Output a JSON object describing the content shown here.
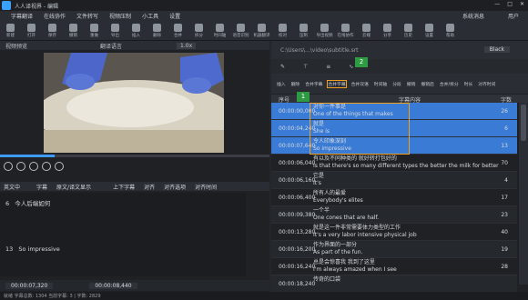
{
  "window": {
    "title": "人人译视界 - 编辑",
    "controls": [
      "—",
      "□",
      "✕"
    ]
  },
  "menu": {
    "items": [
      "字幕翻译",
      "在线协作",
      "文件转写",
      "视频压制",
      "小工具",
      "设置"
    ],
    "right": [
      "系统消息",
      "用户"
    ]
  },
  "toolbar": {
    "items": [
      {
        "label": "新建",
        "icon": "new-icon"
      },
      {
        "label": "打开",
        "icon": "folder-icon"
      },
      {
        "label": "保存",
        "icon": "save-icon"
      },
      {
        "label": "撤销",
        "icon": "undo-icon"
      },
      {
        "label": "重做",
        "icon": "redo-icon"
      },
      {
        "label": "导出",
        "icon": "export-icon"
      },
      {
        "label": "插入",
        "icon": "insert-icon"
      },
      {
        "label": "删除",
        "icon": "delete-icon"
      },
      {
        "label": "合并",
        "icon": "merge-icon"
      },
      {
        "label": "拆分",
        "icon": "split-icon"
      },
      {
        "label": "时间轴",
        "icon": "timeline-icon"
      },
      {
        "label": "语音识别",
        "icon": "mic-icon"
      },
      {
        "label": "机器翻译",
        "icon": "translate-icon"
      },
      {
        "label": "校对",
        "icon": "proof-icon"
      },
      {
        "label": "压制",
        "icon": "burn-icon"
      },
      {
        "label": "导出视频",
        "icon": "video-icon"
      },
      {
        "label": "在线协作",
        "icon": "cloud-icon"
      },
      {
        "label": "云端",
        "icon": "upload-icon"
      },
      {
        "label": "分享",
        "icon": "share-icon"
      },
      {
        "label": "历史",
        "icon": "history-icon"
      },
      {
        "label": "设置",
        "icon": "settings-icon"
      },
      {
        "label": "帮助",
        "icon": "help-icon"
      }
    ]
  },
  "player": {
    "header": "视频预览",
    "subtitle_lang": "翻译语言",
    "speed": "1.0x"
  },
  "editor": {
    "toolbar": [
      "英文中",
      "字幕",
      "原文/译文显示",
      "上下字幕",
      "对齐",
      "对齐选项",
      "对齐时间"
    ],
    "lines": [
      {
        "index": "6",
        "text": "今人后端如何"
      },
      {
        "index": "13",
        "text": "So impressive"
      }
    ],
    "start_time": "00:00:07,320",
    "end_time": "00:00:08,440"
  },
  "subtitle_panel": {
    "path": "C:\\Users\\...\\video\\subtitle.srt",
    "dropdown": "Black",
    "tools": [
      "插入",
      "删除",
      "合并字幕",
      "合并字幕",
      "合并双语",
      "时间轴",
      "分段",
      "撤销",
      "撤销后",
      "合并/拆分",
      "时长",
      "对齐时间"
    ],
    "columns": [
      "序号",
      "字幕内容",
      "字数"
    ],
    "rows": [
      {
        "time": "00:00:00,000",
        "zh": "对你一件事是",
        "en": "One of the things that makes",
        "count": "26",
        "selected": true
      },
      {
        "time": "00:00:04,240",
        "zh": "就是",
        "en": "She is",
        "count": "6",
        "selected": true
      },
      {
        "time": "00:00:07,640",
        "zh": "令人印象深刻",
        "en": "So impressive",
        "count": "13",
        "selected": true
      },
      {
        "time": "00:00:06,040",
        "zh": "有以及不同种类的 就好转打包好的",
        "en": "Is that there's so many different types the better the milk for better",
        "count": "70",
        "selected": false
      },
      {
        "time": "00:00:06,160",
        "zh": "它是",
        "en": "It's",
        "count": "4",
        "selected": false
      },
      {
        "time": "00:00:06,400",
        "zh": "所有人的最爱",
        "en": "Everybody's elites",
        "count": "17",
        "selected": false
      },
      {
        "time": "00:00:09,380",
        "zh": "一个半",
        "en": "One cones that are half.",
        "count": "23",
        "selected": false
      },
      {
        "time": "00:00:13,280",
        "zh": "就是这一件非常需要体力类型的工作",
        "en": "It's a very labor intensive physical job",
        "count": "40",
        "selected": false
      },
      {
        "time": "00:00:16,200",
        "zh": "作为界面的一部分",
        "en": "As part of the fun.",
        "count": "19",
        "selected": false
      },
      {
        "time": "00:00:16,240",
        "zh": "总是会惊喜我 我到了这里",
        "en": "I'm always amazed when I see",
        "count": "28",
        "selected": false
      },
      {
        "time": "00:00:18,240",
        "zh": "传奇的口袋",
        "en": "",
        "count": "",
        "selected": false
      }
    ]
  },
  "status": {
    "text": "就绪 字幕总数: 1304 当前字幕: 3 | 字数: 2829"
  },
  "badges": [
    "1",
    "2"
  ]
}
